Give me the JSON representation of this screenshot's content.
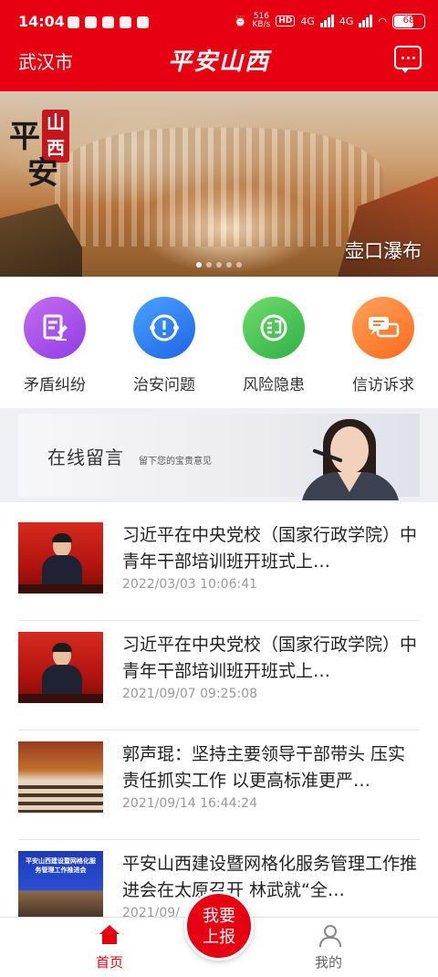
{
  "status_bar": {
    "time": "14:04",
    "network_speed": "516",
    "network_unit": "KB/s",
    "hd_badge": "HD",
    "signal1_label": "4G",
    "signal2_label": "4G",
    "battery": "68"
  },
  "header": {
    "city": "武汉市",
    "app_title": "平安山西",
    "message_icon": "message-icon"
  },
  "banner": {
    "seal_text": "山西",
    "calligraphy_1": "平",
    "calligraphy_2": "安",
    "caption": "壶口瀑布",
    "dots_total": 5,
    "active_index": 0
  },
  "actions": [
    {
      "label": "矛盾纠纷",
      "icon": "dispute-icon",
      "color": "#a94ff0"
    },
    {
      "label": "治安问题",
      "icon": "security-alert-icon",
      "color": "#2f7cf0"
    },
    {
      "label": "风险隐患",
      "icon": "risk-icon",
      "color": "#3ec155"
    },
    {
      "label": "信访诉求",
      "icon": "petition-icon",
      "color": "#ff7a2f"
    }
  ],
  "online_message": {
    "title": "在线留言",
    "subtitle": "留下您的宝贵意见"
  },
  "news": [
    {
      "title": "习近平在中央党校（国家行政学院）中青年干部培训班开班式上…",
      "date": "2022/03/03 10:06:41"
    },
    {
      "title": "习近平在中央党校（国家行政学院）中青年干部培训班开班式上…",
      "date": "2021/09/07 09:25:08"
    },
    {
      "title": "郭声琨：坚持主要领导干部带头 压实责任抓实工作 以更高标准更严…",
      "date": "2021/09/14 16:44:24"
    },
    {
      "title": "平安山西建设暨网格化服务管理工作推进会在太原召开 林武就“全…",
      "date": "2021/09/",
      "thumb_caption": "平安山西建设暨网格化服务管理工作推进会"
    }
  ],
  "bottom_nav": {
    "home_label": "首页",
    "report_line1": "我要",
    "report_line2": "上报",
    "me_label": "我的"
  },
  "colors": {
    "brand_red": "#e60012"
  }
}
